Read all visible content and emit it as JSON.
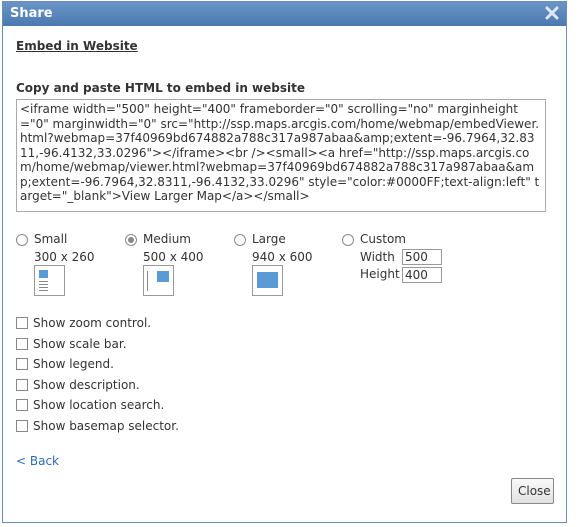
{
  "dialog": {
    "title": "Share",
    "close_icon": "close-x-icon"
  },
  "section_title": "Embed in Website",
  "copy_label": "Copy and paste HTML to embed in website",
  "embed_code": "<iframe width=\"500\" height=\"400\" frameborder=\"0\" scrolling=\"no\" marginheight=\"0\" marginwidth=\"0\" src=\"http://ssp.maps.arcgis.com/home/webmap/embedViewer.html?webmap=37f40969bd674882a788c317a987abaa&amp;extent=-96.7964,32.8311,-96.4132,33.0296\"></iframe><br /><small><a href=\"http://ssp.maps.arcgis.com/home/webmap/viewer.html?webmap=37f40969bd674882a788c317a987abaa&amp;extent=-96.7964,32.8311,-96.4132,33.0296\" style=\"color:#0000FF;text-align:left\" target=\"_blank\">View Larger Map</a></small>",
  "sizes": [
    {
      "label": "Small",
      "dims": "300 x 260",
      "selected": false
    },
    {
      "label": "Medium",
      "dims": "500 x 400",
      "selected": true
    },
    {
      "label": "Large",
      "dims": "940 x 600",
      "selected": false
    },
    {
      "label": "Custom",
      "selected": false
    }
  ],
  "custom": {
    "width_label": "Width",
    "width_value": "500",
    "height_label": "Height",
    "height_value": "400"
  },
  "options": [
    {
      "label": "Show zoom control.",
      "checked": false
    },
    {
      "label": "Show scale bar.",
      "checked": false
    },
    {
      "label": "Show legend.",
      "checked": false
    },
    {
      "label": "Show description.",
      "checked": false
    },
    {
      "label": "Show location search.",
      "checked": false
    },
    {
      "label": "Show basemap selector.",
      "checked": false
    }
  ],
  "back_link": "< Back",
  "close_button": "Close",
  "colors": {
    "titlebar": "#5a86bd",
    "link": "#2f6cb3",
    "thumb_blue": "#5b9bd5"
  }
}
